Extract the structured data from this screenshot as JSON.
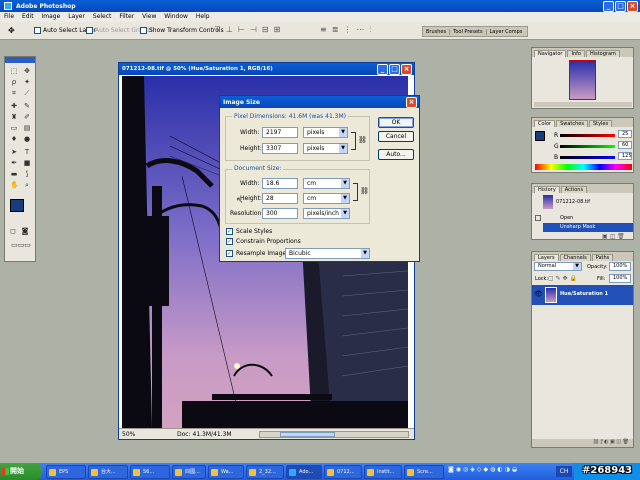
{
  "app": {
    "title": "Adobe Photoshop"
  },
  "menu": [
    "File",
    "Edit",
    "Image",
    "Layer",
    "Select",
    "Filter",
    "View",
    "Window",
    "Help"
  ],
  "options": {
    "auto_select_layer": "Auto Select Layer",
    "auto_select_groups": "Auto Select Groups",
    "show_transform": "Show Transform Controls"
  },
  "well": {
    "tabs": [
      "Brushes",
      "Tool Presets",
      "Layer Comps"
    ]
  },
  "document": {
    "title": "071212-08.tif @ 50% (Hue/Saturation 1, RGB/16)",
    "zoom": "50%",
    "doc_info": "Doc: 41.3M/41.3M"
  },
  "dialog": {
    "title": "Image Size",
    "pixel_dimensions": "Pixel Dimensions: 41.6M (was 41.3M)",
    "width_label": "Width:",
    "width_value": "2197",
    "width_unit": "pixels",
    "height_label": "Height:",
    "height_value": "3307",
    "height_unit": "pixels",
    "document_size": "Document Size:",
    "doc_width_label": "Width:",
    "doc_width_value": "18.6",
    "doc_width_unit": "cm",
    "doc_height_label": "Height:",
    "doc_height_value": "28",
    "doc_height_unit": "cm",
    "resolution_label": "Resolution:",
    "resolution_value": "300",
    "resolution_unit": "pixels/inch",
    "scale_styles": "Scale Styles",
    "constrain": "Constrain Proportions",
    "resample": "Resample Image:",
    "resample_method": "Bicubic",
    "ok": "OK",
    "cancel": "Cancel",
    "auto": "Auto..."
  },
  "navigator": {
    "tabs": [
      "Navigator",
      "Info",
      "Histogram"
    ]
  },
  "color": {
    "tabs": [
      "Color",
      "Swatches",
      "Styles"
    ],
    "r_label": "R",
    "g_label": "G",
    "b_label": "B",
    "r": "25",
    "g": "60",
    "b": "125",
    "fg_color": "#193c7d"
  },
  "history": {
    "tabs": [
      "History",
      "Actions"
    ],
    "snapshot": "071212-08.tif",
    "items": [
      "Open",
      "Unsharp Mask"
    ]
  },
  "layers": {
    "tabs": [
      "Layers",
      "Channels",
      "Paths"
    ],
    "blend_mode": "Normal",
    "opacity_label": "Opacity:",
    "opacity": "100%",
    "lock_label": "Lock:",
    "fill_label": "Fill:",
    "fill": "100%",
    "layer_name": "Hue/Saturation 1"
  },
  "taskbar": {
    "start": "開始",
    "items": [
      "EPS",
      "台大...",
      "56...",
      "四國...",
      "Wa...",
      "2_32...",
      "Ado...",
      "0712...",
      "Instit...",
      "Scre..."
    ],
    "lang": "CH",
    "watermark": "#268943"
  }
}
